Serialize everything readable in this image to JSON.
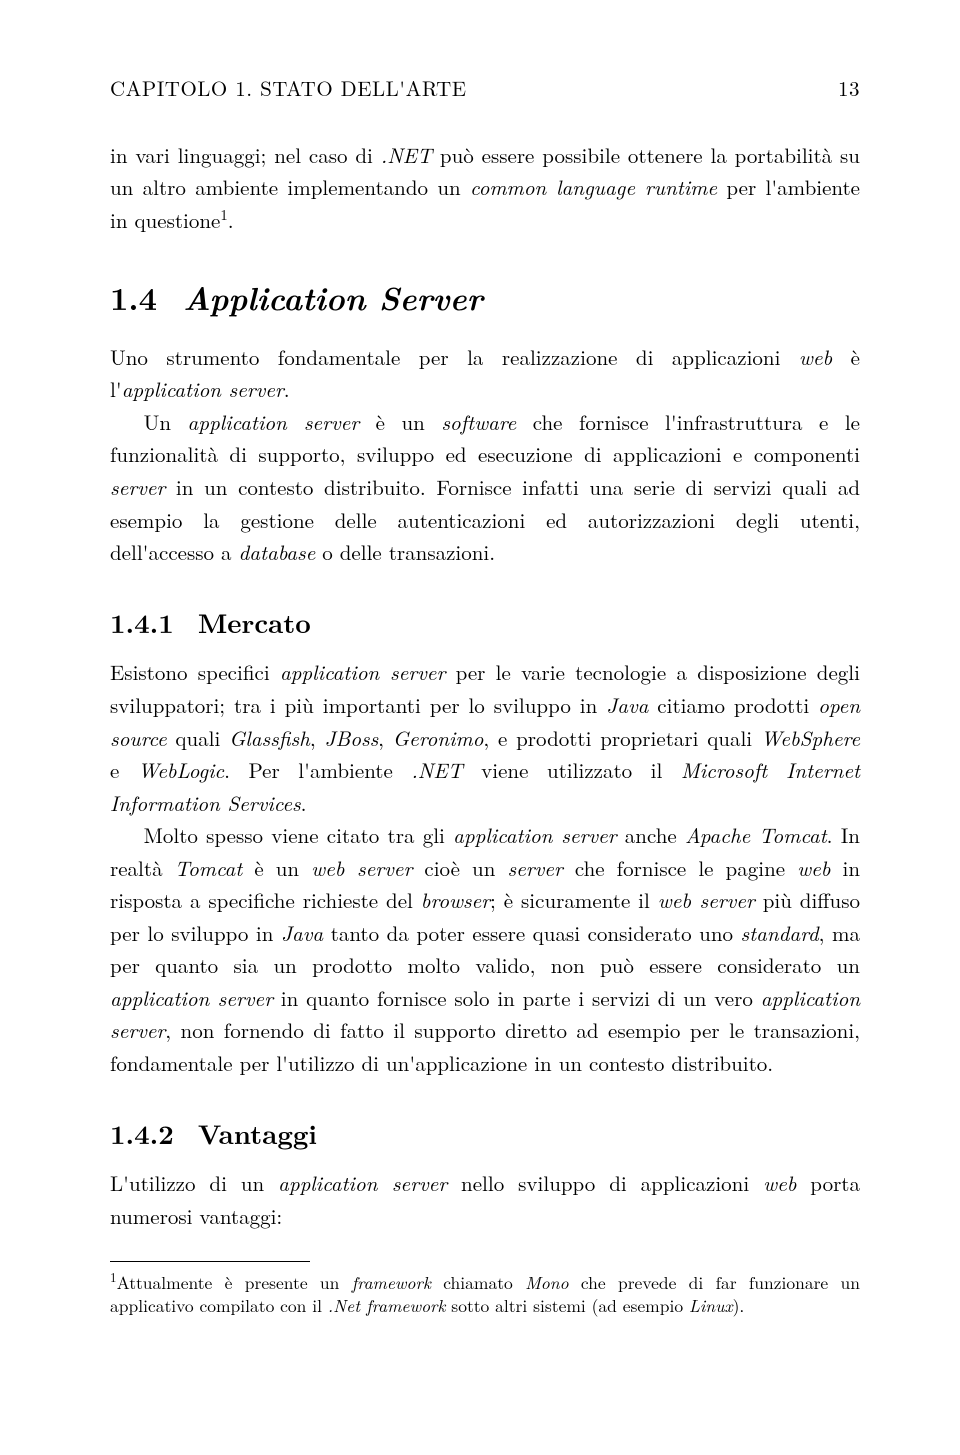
{
  "header": {
    "left": "CAPITOLO 1. STATO DELL'ARTE",
    "right": "13"
  },
  "intro_cont": {
    "t1": "in vari linguaggi; nel caso di ",
    "net": ".NET",
    "t2": " può essere possibile ottenere la portabilità su un altro ambiente implementando un ",
    "clr": "common language runtime",
    "t3": " per l'ambiente in questione",
    "fn": "1",
    "t4": "."
  },
  "sec14": {
    "num": "1.4",
    "title": "Application Server",
    "p1": {
      "t1": "Uno strumento fondamentale per la realizzazione di applicazioni ",
      "web": "web",
      "t2": " è l'",
      "as": "application server",
      "t3": "."
    },
    "p2": {
      "t1": "Un ",
      "as": "application server",
      "t2": " è un ",
      "sw": "software",
      "t3": " che fornisce l'infrastruttura e le funzionalità di supporto, sviluppo ed esecuzione di applicazioni e componenti ",
      "srv": "server",
      "t4": " in un contesto distribuito. Fornisce infatti una serie di servizi quali ad esempio la gestione delle autenticazioni ed autorizzazioni degli utenti, dell'accesso a ",
      "db": "database",
      "t5": " o delle transazioni."
    }
  },
  "sec141": {
    "num": "1.4.1",
    "title": "Mercato",
    "p1": {
      "t1": "Esistono specifici ",
      "as": "application server",
      "t2": " per le varie tecnologie a disposizione degli sviluppatori; tra i più importanti per lo sviluppo in ",
      "java": "Java",
      "t3": " citiamo prodotti ",
      "os": "open source",
      "t4": " quali ",
      "gf": "Glassfish",
      "c1": ", ",
      "jb": "JBoss",
      "c2": ", ",
      "ge": "Geronimo",
      "t5": ", e prodotti proprietari quali ",
      "ws": "WebSphere",
      "t6": " e ",
      "wl": "WebLogic",
      "t7": ". Per l'ambiente ",
      "net": ".NET",
      "t8": " viene utilizzato il ",
      "iis": "Microsoft Internet Information Services",
      "t9": "."
    },
    "p2": {
      "t1": "Molto spesso viene citato tra gli ",
      "as": "application server",
      "t2": " anche ",
      "at": "Apache Tomcat",
      "t3": ". In realtà ",
      "tc": "Tomcat",
      "t4": " è un ",
      "wserv": "web server",
      "t5": " cioè un ",
      "srv": "server",
      "t6": " che fornisce le pagine ",
      "web": "web",
      "t7": " in risposta a specifiche richieste del ",
      "br": "browser",
      "t8": "; è sicuramente il ",
      "wserv2": "web server",
      "t9": " più diffuso per lo sviluppo in ",
      "java": "Java",
      "t10": " tanto da poter essere quasi considerato uno ",
      "std": "standard",
      "t11": ", ma per quanto sia un prodotto molto valido, non può essere considerato un ",
      "as2": "application server",
      "t12": " in quanto fornisce solo in parte i servizi di un vero ",
      "as3": "application server",
      "t13": ", non fornendo di fatto il supporto diretto ad esempio per le transazioni, fondamentale per l'utilizzo di un'applicazione in un contesto distribuito."
    }
  },
  "sec142": {
    "num": "1.4.2",
    "title": "Vantaggi",
    "p1": {
      "t1": "L'utilizzo di un ",
      "as": "application server",
      "t2": " nello sviluppo di applicazioni ",
      "web": "web",
      "t3": " porta numerosi vantaggi:"
    }
  },
  "footnote": {
    "mark": "1",
    "t1": "Attualmente è presente un ",
    "fw": "framework",
    "t2": " chiamato ",
    "mono": "Mono",
    "t3": " che prevede di far funzionare un applicativo compilato con il ",
    "nf": ".Net framework",
    "t4": " sotto altri sistemi (ad esempio ",
    "lx": "Linux",
    "t5": ")."
  }
}
